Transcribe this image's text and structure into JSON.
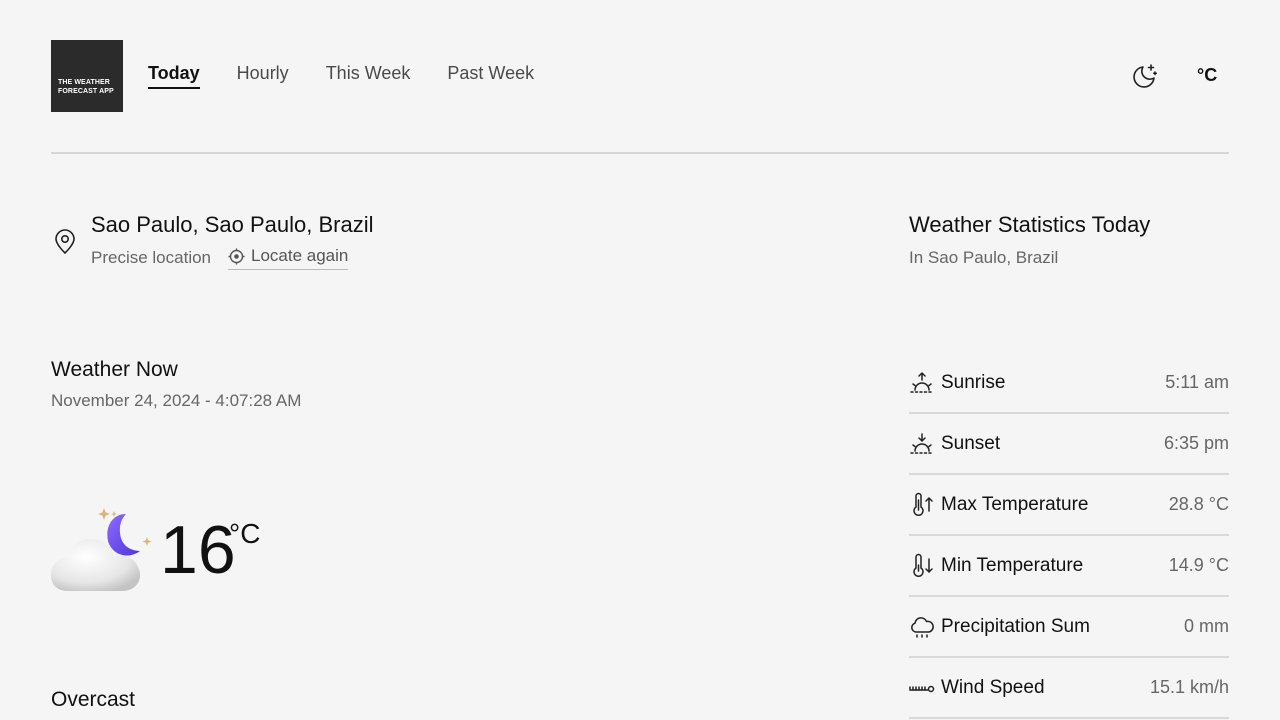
{
  "app": {
    "logo_text": "THE WEATHER FORECAST APP"
  },
  "nav": {
    "tabs": [
      {
        "label": "Today",
        "active": true
      },
      {
        "label": "Hourly",
        "active": false
      },
      {
        "label": "This Week",
        "active": false
      },
      {
        "label": "Past Week",
        "active": false
      }
    ],
    "theme_icon": "moon-stars-icon",
    "unit_label": "°C"
  },
  "location": {
    "name": "Sao Paulo, Sao Paulo, Brazil",
    "precision_label": "Precise location",
    "locate_again_label": "Locate again"
  },
  "stats_header": {
    "title": "Weather Statistics Today",
    "subtitle": "In Sao Paulo, Brazil"
  },
  "now": {
    "title": "Weather Now",
    "datetime": "November 24, 2024 - 4:07:28 AM",
    "temperature": "16",
    "unit": "°C",
    "condition": "Overcast",
    "icon": "cloud-moon-icon"
  },
  "stats": [
    {
      "icon": "sunrise-icon",
      "label": "Sunrise",
      "value": "5:11 am"
    },
    {
      "icon": "sunset-icon",
      "label": "Sunset",
      "value": "6:35 pm"
    },
    {
      "icon": "thermometer-up-icon",
      "label": "Max Temperature",
      "value": "28.8 °C"
    },
    {
      "icon": "thermometer-down-icon",
      "label": "Min Temperature",
      "value": "14.9 °C"
    },
    {
      "icon": "cloud-rain-icon",
      "label": "Precipitation Sum",
      "value": "0 mm"
    },
    {
      "icon": "wind-icon",
      "label": "Wind Speed",
      "value": "15.1 km/h"
    }
  ],
  "colors": {
    "background": "#f5f5f5",
    "text": "#111111",
    "muted": "#666666",
    "logo_bg": "#2b2b2b",
    "moon_accent": "#6a4cf0"
  }
}
